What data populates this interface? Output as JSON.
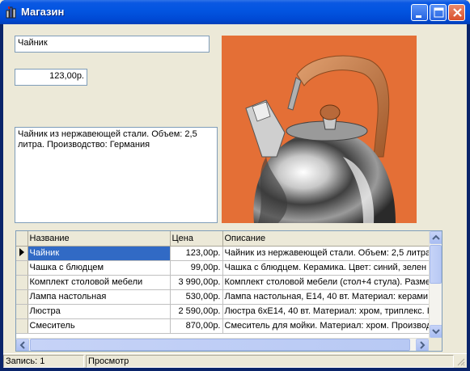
{
  "window": {
    "title": "Магазин"
  },
  "form": {
    "name_value": "Чайник",
    "price_value": "123,00р.",
    "description_value": "Чайник из нержавеющей стали. Объем: 2,5 литра. Производство: Германия"
  },
  "grid": {
    "columns": [
      "Название",
      "Цена",
      "Описание"
    ],
    "rows": [
      {
        "name": "Чайник",
        "price": "123,00р.",
        "description": "Чайник из нержавеющей стали. Объем: 2,5 литра"
      },
      {
        "name": "Чашка с блюдцем",
        "price": "99,00р.",
        "description": "Чашка с блюдцем. Керамика. Цвет: синий, зелен"
      },
      {
        "name": "Комплект столовой мебели",
        "price": "3 990,00р.",
        "description": "Комплект столовой мебели (стол+4 стула). Разме"
      },
      {
        "name": "Лампа настольная",
        "price": "530,00р.",
        "description": "Лампа настольная, E14, 40 вт. Материал: керами"
      },
      {
        "name": "Люстра",
        "price": "2 590,00р.",
        "description": "Люстра 6хE14, 40 вт. Материал: хром, триплекс. I"
      },
      {
        "name": "Смеситель",
        "price": "870,00р.",
        "description": "Смеситель для мойки. Материал: хром. Производ"
      }
    ],
    "selected_row": 0
  },
  "status": {
    "record": "Запись: 1",
    "mode": "Просмотр"
  },
  "colors": {
    "titlebar": "#0054e3",
    "selection": "#316ac5",
    "photo_background": "#e8743a"
  }
}
